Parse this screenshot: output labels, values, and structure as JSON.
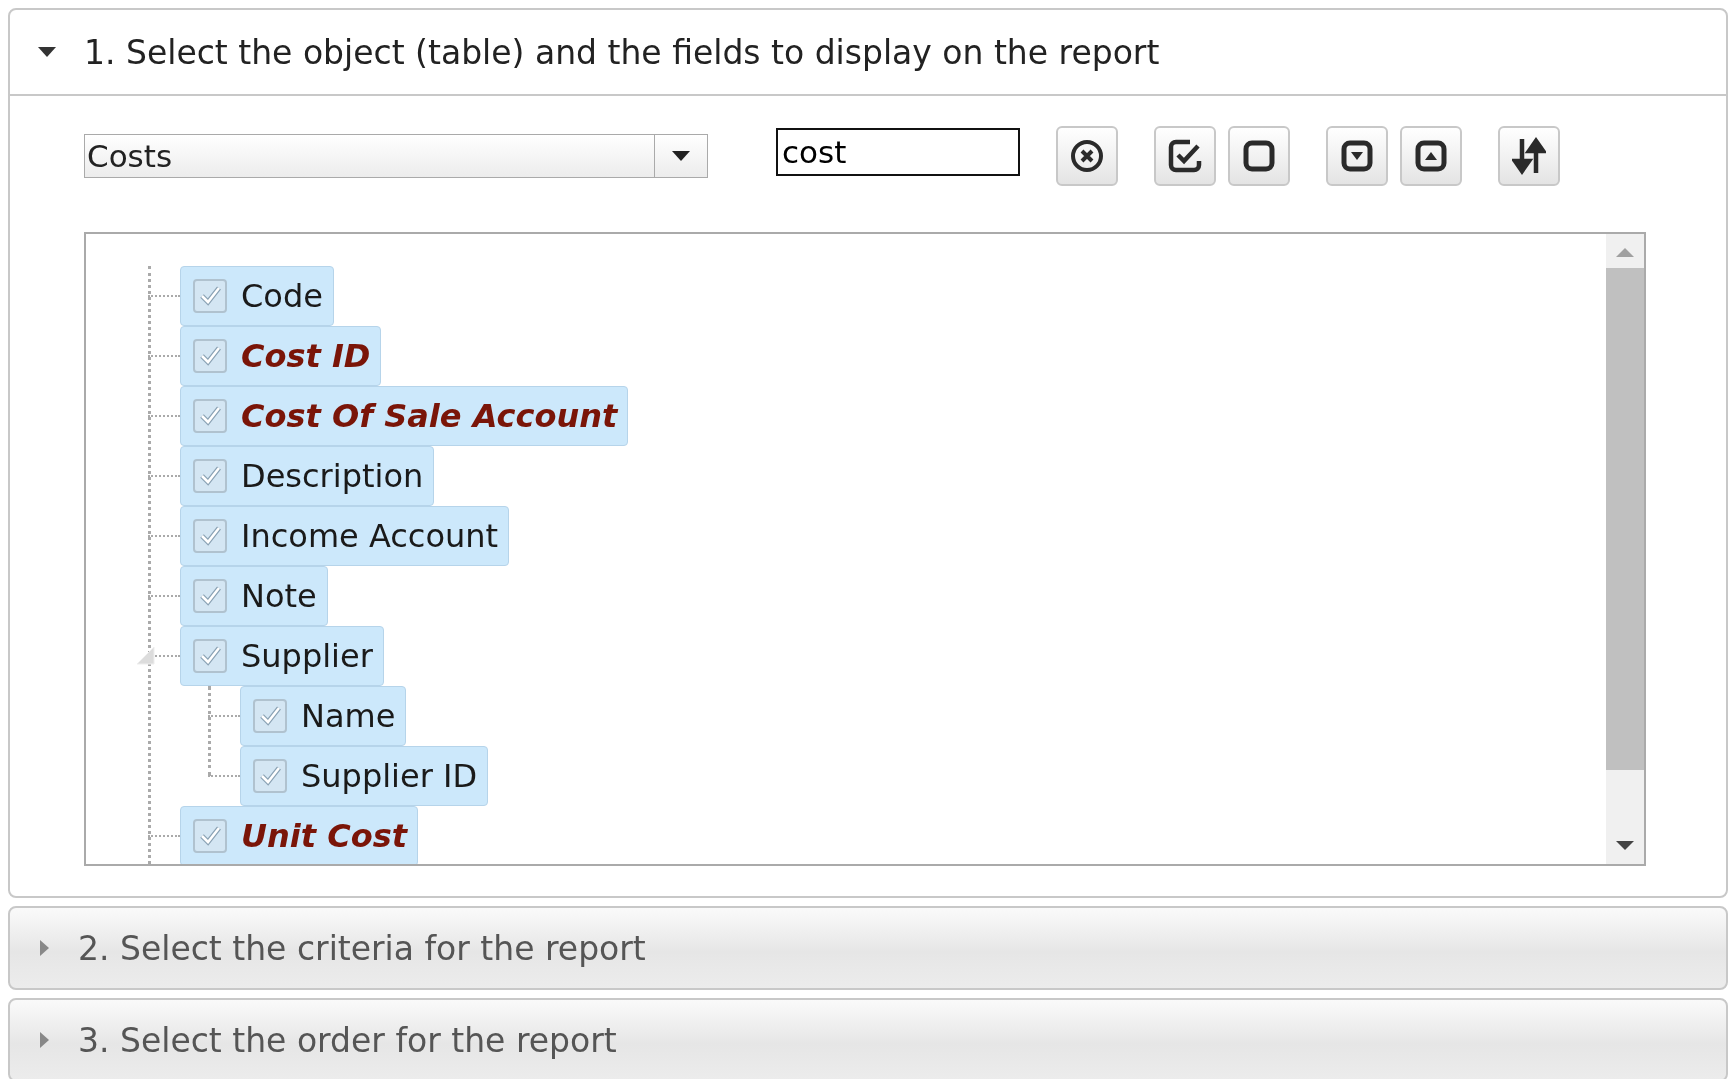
{
  "sections": [
    {
      "title": "1. Select the object (table) and the fields to display on the report",
      "expanded": true
    },
    {
      "title": "2. Select the criteria for the report",
      "expanded": false
    },
    {
      "title": "3. Select the order for the report",
      "expanded": false
    }
  ],
  "object_select": {
    "value": "Costs"
  },
  "filter": {
    "value": "cost"
  },
  "toolbar": [
    {
      "kind": "clear"
    },
    {
      "kind": "check-all"
    },
    {
      "kind": "uncheck-all"
    },
    {
      "kind": "expand-all"
    },
    {
      "kind": "collapse-all"
    },
    {
      "kind": "sort"
    }
  ],
  "fields": [
    {
      "label": "Code",
      "checked": true,
      "selected": true,
      "emphasized": false
    },
    {
      "label": "Cost ID",
      "checked": true,
      "selected": true,
      "emphasized": true
    },
    {
      "label": "Cost Of Sale Account",
      "checked": true,
      "selected": true,
      "emphasized": true
    },
    {
      "label": "Description",
      "checked": true,
      "selected": true,
      "emphasized": false
    },
    {
      "label": "Income Account",
      "checked": true,
      "selected": true,
      "emphasized": false
    },
    {
      "label": "Note",
      "checked": true,
      "selected": true,
      "emphasized": false
    },
    {
      "label": "Supplier",
      "checked": true,
      "selected": true,
      "emphasized": false,
      "expanded": true,
      "children": [
        {
          "label": "Name",
          "checked": true,
          "selected": true,
          "emphasized": false
        },
        {
          "label": "Supplier ID",
          "checked": true,
          "selected": true,
          "emphasized": false
        }
      ]
    },
    {
      "label": "Unit Cost",
      "checked": true,
      "selected": true,
      "emphasized": true
    }
  ]
}
